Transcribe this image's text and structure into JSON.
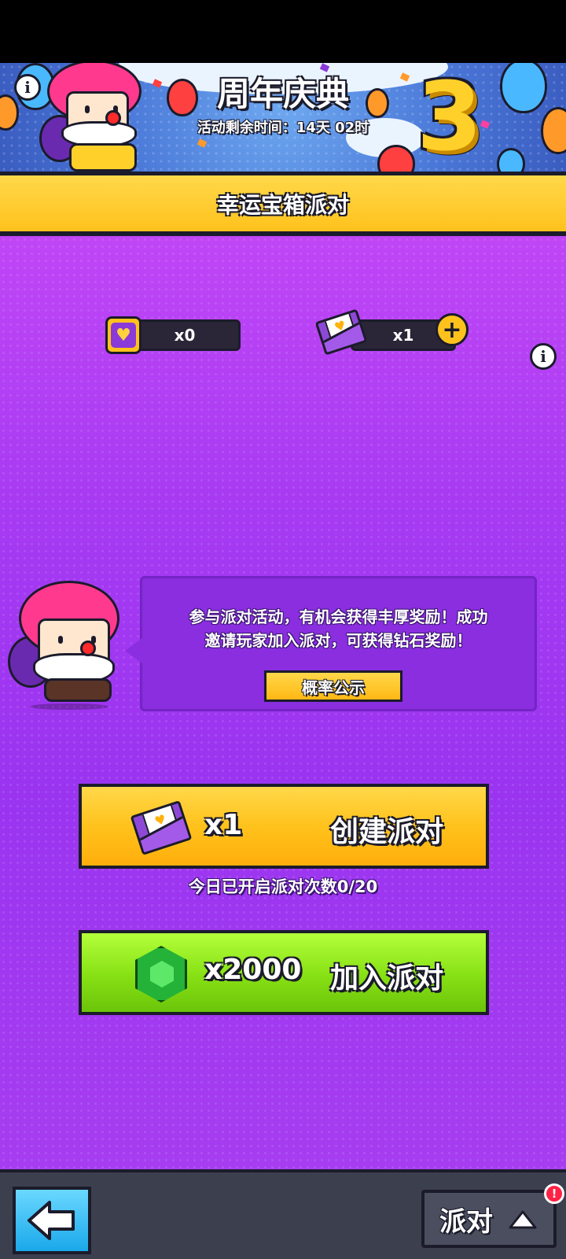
{
  "banner": {
    "title": "周年庆典",
    "timer": "活动剩余时间：14天 02时",
    "anniversary_number": "3"
  },
  "title_bar": {
    "title": "幸运宝箱派对"
  },
  "counters": {
    "hearts": "x0",
    "envelopes": "x1"
  },
  "speech": {
    "line1": "参与派对活动，有机会获得丰厚奖励！成功",
    "line2": "邀请玩家加入派对，可获得钻石奖励！",
    "probability_label": "概率公示"
  },
  "create_party": {
    "cost": "x1",
    "label": "创建派对"
  },
  "today_count": "今日已开启派对次数0/20",
  "join_party": {
    "cost": "x2000",
    "label": "加入派对"
  },
  "bottom_bar": {
    "party_label": "派对",
    "alert": "!"
  },
  "colors": {
    "purple_bg": "#a63af2",
    "yellow": "#ffc21c",
    "green": "#86e014",
    "blue": "#1aa8ea"
  },
  "icons": [
    "info-icon",
    "heart-icon",
    "envelope-icon",
    "plus-icon",
    "gem-icon",
    "back-arrow-icon",
    "chevron-up-icon"
  ]
}
